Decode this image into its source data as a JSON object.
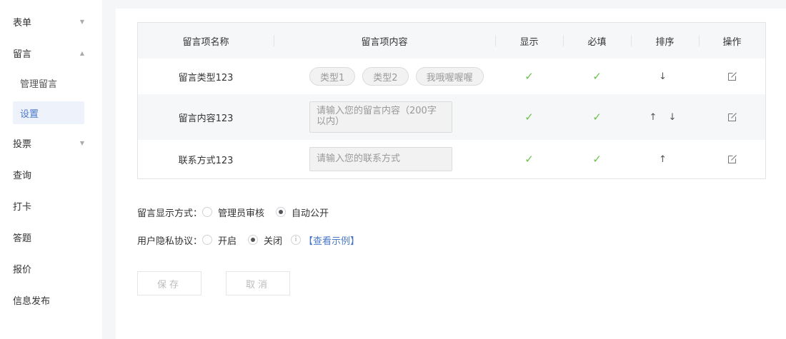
{
  "sidebar": {
    "groups": [
      {
        "label": "表单",
        "expanded": false
      },
      {
        "label": "留言",
        "expanded": true,
        "children": [
          "管理留言",
          "设置"
        ],
        "active_child": "设置"
      },
      {
        "label": "投票",
        "expanded": false
      },
      {
        "label": "查询"
      },
      {
        "label": "打卡"
      },
      {
        "label": "答题"
      },
      {
        "label": "报价"
      },
      {
        "label": "信息发布"
      }
    ]
  },
  "table": {
    "headers": [
      "留言项名称",
      "留言项内容",
      "显示",
      "必填",
      "排序",
      "操作"
    ],
    "rows": [
      {
        "name": "留言类型123",
        "tags": [
          "类型1",
          "类型2",
          "我哦喔喔喔"
        ],
        "show": "✓",
        "required": "✓",
        "sort": "↓"
      },
      {
        "name": "留言内容123",
        "placeholder": "请输入您的留言内容（200字以内）",
        "show": "✓",
        "required": "✓",
        "sort": "↑ ↓"
      },
      {
        "name": "联系方式123",
        "placeholder": "请输入您的联系方式",
        "show": "✓",
        "required": "✓",
        "sort": "↑"
      }
    ]
  },
  "options": {
    "display_mode": {
      "label": "留言显示方式：",
      "choices": [
        "管理员审核",
        "自动公开"
      ],
      "selected": "自动公开"
    },
    "privacy": {
      "label": "用户隐私协议：",
      "choices": [
        "开启",
        "关闭"
      ],
      "selected": "关闭",
      "info_icon_text": "i",
      "link": "【查看示例】"
    }
  },
  "buttons": {
    "save": "保存",
    "cancel": "取消"
  },
  "colors": {
    "accent": "#4a78c9",
    "check": "#6cc04a",
    "active_bg": "#eef2fb"
  }
}
